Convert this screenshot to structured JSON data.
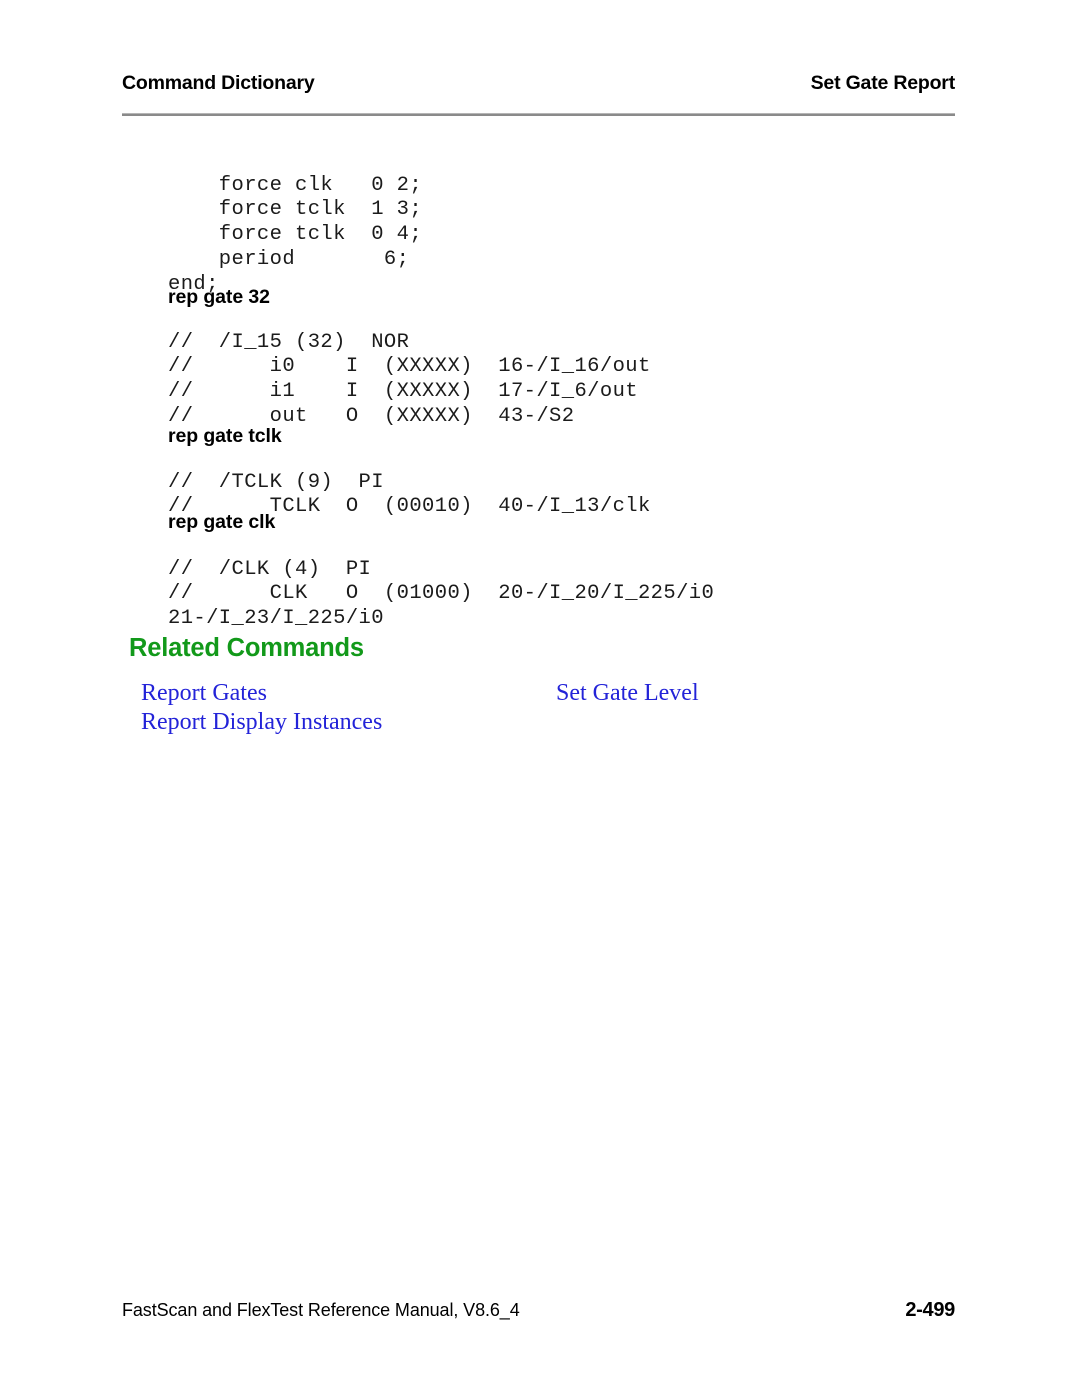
{
  "header": {
    "left_title": "Command Dictionary",
    "right_title": "Set Gate Report"
  },
  "body": {
    "code_top": "    force clk   0 2;\n    force tclk  1 3;\n    force tclk  0 4;\n    period       6;\nend;",
    "examples": [
      {
        "label": "rep gate 32",
        "output": "//  /I_15 (32)  NOR\n//      i0    I  (XXXXX)  16-/I_16/out\n//      i1    I  (XXXXX)  17-/I_6/out\n//      out   O  (XXXXX)  43-/S2"
      },
      {
        "label": "rep gate tclk",
        "output": "//  /TCLK (9)  PI\n//      TCLK  O  (00010)  40-/I_13/clk"
      },
      {
        "label": "rep gate clk",
        "output": "//  /CLK (4)  PI\n//      CLK   O  (01000)  20-/I_20/I_225/i0\n21-/I_23/I_225/i0"
      }
    ]
  },
  "related_commands": {
    "heading": "Related Commands",
    "heading_color": "#12991a",
    "link_color": "#2323d8",
    "rows": [
      {
        "left": "Report Gates",
        "right": "Set Gate Level"
      },
      {
        "left": "Report Display Instances",
        "right": ""
      }
    ]
  },
  "footer": {
    "manual_text": "FastScan and FlexTest Reference Manual, V8.6_4",
    "page_number": "2-499"
  }
}
